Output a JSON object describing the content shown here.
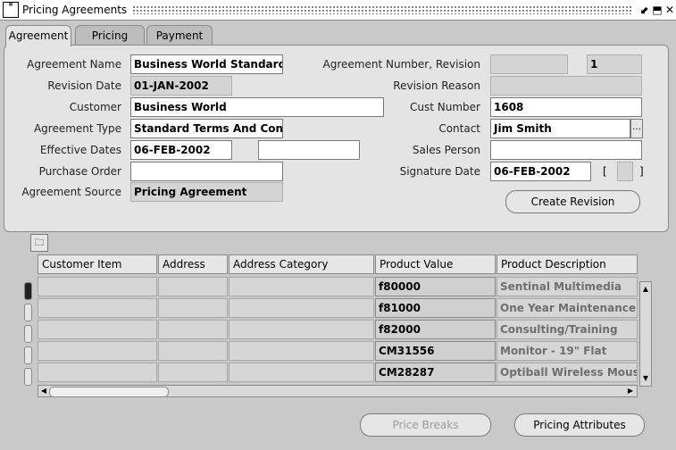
{
  "window": {
    "title": "Pricing Agreements",
    "icon": "oracle-forms-icon"
  },
  "tabs": [
    {
      "label": "Agreement",
      "active": true
    },
    {
      "label": "Pricing",
      "active": false
    },
    {
      "label": "Payment",
      "active": false
    }
  ],
  "form": {
    "agreement_name": {
      "label": "Agreement Name",
      "value": "Business World Standard Agreement"
    },
    "agreement_number": {
      "label": "Agreement Number, Revision",
      "value": "",
      "revision": "1"
    },
    "revision_date": {
      "label": "Revision Date",
      "value": "01-JAN-2002"
    },
    "revision_reason": {
      "label": "Revision Reason",
      "value": ""
    },
    "customer": {
      "label": "Customer",
      "value": "Business World"
    },
    "cust_number": {
      "label": "Cust Number",
      "value": "1608"
    },
    "agreement_type": {
      "label": "Agreement Type",
      "value": "Standard Terms And Conditions"
    },
    "contact": {
      "label": "Contact",
      "value": "Jim Smith"
    },
    "effective_dates": {
      "label": "Effective Dates",
      "from": "06-FEB-2002",
      "to": ""
    },
    "sales_person": {
      "label": "Sales Person",
      "value": ""
    },
    "purchase_order": {
      "label": "Purchase Order",
      "value": ""
    },
    "signature_date": {
      "label": "Signature Date",
      "value": "06-FEB-2002"
    },
    "agreement_source": {
      "label": "Agreement Source",
      "value": "Pricing Agreement"
    },
    "create_revision": "Create Revision"
  },
  "grid": {
    "columns": [
      "Customer Item",
      "Address",
      "Address Category",
      "Product Value",
      "Product Description"
    ],
    "rows": [
      {
        "product_value": "f80000",
        "product_description": "Sentinal Multimedia"
      },
      {
        "product_value": "f81000",
        "product_description": "One Year Maintenance - Sentinal"
      },
      {
        "product_value": "f82000",
        "product_description": "Consulting/Training"
      },
      {
        "product_value": "CM31556",
        "product_description": "Monitor - 19\" Flat"
      },
      {
        "product_value": "CM28287",
        "product_description": "Optiball Wireless Mouse"
      }
    ]
  },
  "buttons": {
    "price_breaks": "Price Breaks",
    "pricing_attributes": "Pricing Attributes"
  }
}
